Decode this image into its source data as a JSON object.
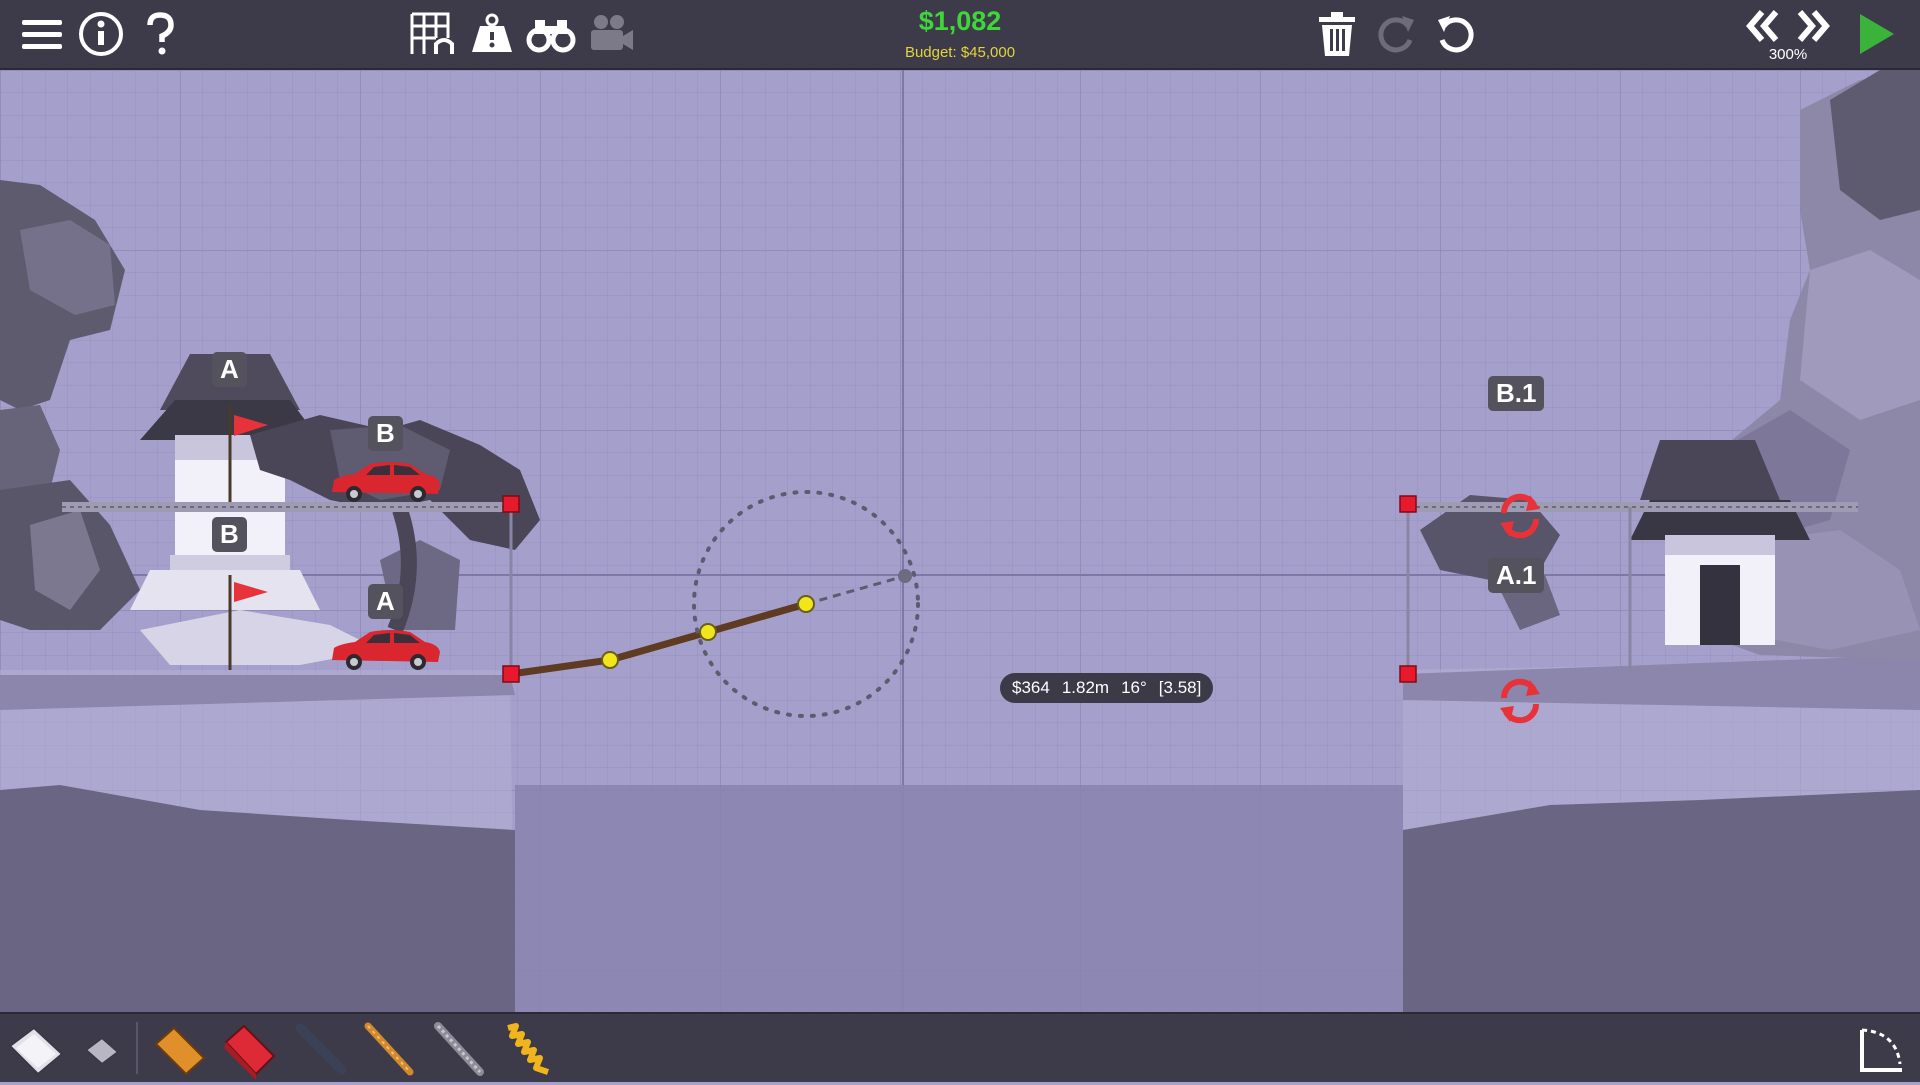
{
  "hud": {
    "cost": "$1,082",
    "budget": "Budget: $45,000",
    "speed": "300%"
  },
  "measure": {
    "cost": "$364",
    "length": "1.82m",
    "angle": "16°",
    "stress": "[3.58]"
  },
  "labels": {
    "flag_top": "A",
    "car_top": "B",
    "flag_bottom": "B",
    "car_bottom": "A",
    "target_top": "B.1",
    "target_bottom": "A.1"
  },
  "colors": {
    "bar": "#3d3b4a",
    "grid_bg": "#a59fcb",
    "money": "#3fd63a",
    "budget": "#e3d33c",
    "anchor": "#e8192c",
    "joint": "#f1e51c",
    "road": "#5e3b22",
    "car": "#d9262f",
    "play": "#3bb23a"
  },
  "icons": {
    "top_left": [
      "menu-icon",
      "info-icon",
      "help-icon"
    ],
    "top_center": [
      "grid-icon",
      "weight-icon",
      "binoculars-icon",
      "camera-icon"
    ],
    "top_right": [
      "trash-icon",
      "redo-icon",
      "undo-icon",
      "rewind-icon",
      "fast-forward-icon",
      "play-icon"
    ],
    "tools": [
      "road-tool-icon",
      "reinforced-road-tool-icon",
      "wood-tool-icon",
      "steel-tool-icon",
      "hydraulic-tool-icon",
      "rope-tool-icon",
      "cable-tool-icon",
      "spring-tool-icon",
      "pan-tool-icon"
    ]
  }
}
